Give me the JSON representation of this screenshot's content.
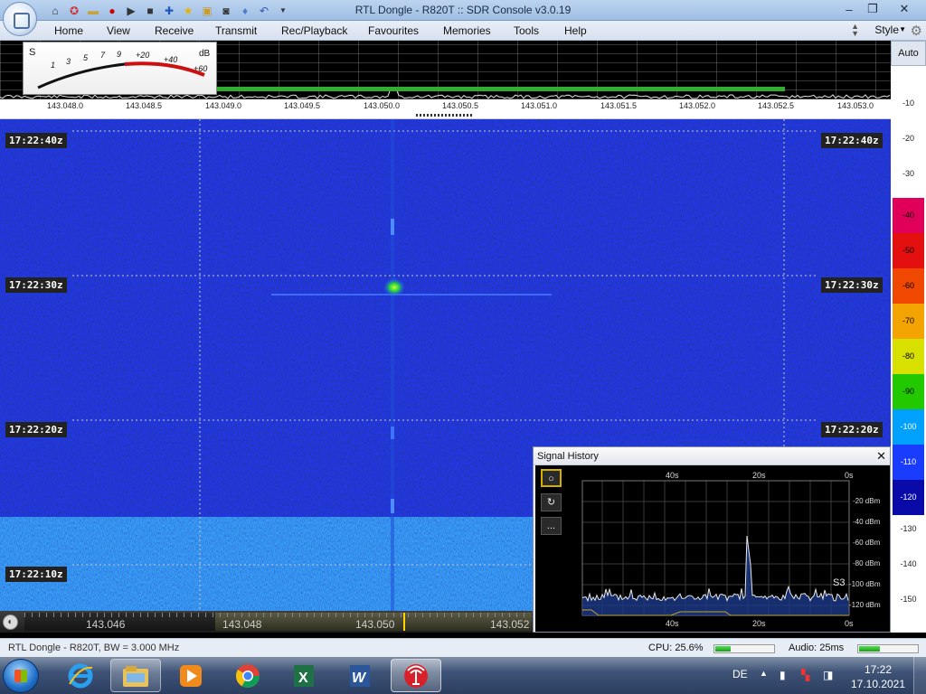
{
  "window": {
    "title": "RTL Dongle - R820T :: SDR Console v3.0.19",
    "minimize_icon": "minimize-icon",
    "maximize_icon": "maximize-icon",
    "close_icon": "close-icon"
  },
  "quick_access": [
    "home-icon",
    "lifebuoy-icon",
    "folder-icon",
    "record-icon",
    "play-icon",
    "stop-icon",
    "add-icon",
    "star-icon",
    "lock-icon",
    "camera-icon",
    "drop-icon",
    "undo-icon",
    "dropdown-icon"
  ],
  "menu": {
    "tabs": [
      "Home",
      "View",
      "Receive",
      "Transmit",
      "Rec/Playback",
      "Favourites",
      "Memories",
      "Tools",
      "Help"
    ],
    "style_label": "Style"
  },
  "smeter": {
    "s_label": "S",
    "db_label": "dB",
    "scale": [
      "1",
      "3",
      "5",
      "7",
      "9",
      "+20",
      "+40",
      "+60"
    ],
    "reading_fraction": 0.12
  },
  "spectrum": {
    "auto_label": "Auto",
    "freq_ticks": [
      "143.048.0",
      "143.048.5",
      "143.049.0",
      "143.049.5",
      "143.050.0",
      "143.050.5",
      "143.051.0",
      "143.051.5",
      "143.052.0",
      "143.052.5",
      "143.053.0"
    ]
  },
  "db_scale": {
    "labels": [
      "-10",
      "-20",
      "-30",
      "-40",
      "-50",
      "-60",
      "-70",
      "-80",
      "-90",
      "-100",
      "-110",
      "-120",
      "-130",
      "-140",
      "-150"
    ],
    "colored": [
      {
        "label": "-40",
        "color": "#e0005a"
      },
      {
        "label": "-50",
        "color": "#e41010"
      },
      {
        "label": "-60",
        "color": "#f04800"
      },
      {
        "label": "-70",
        "color": "#f4a400"
      },
      {
        "label": "-80",
        "color": "#d8e000"
      },
      {
        "label": "-90",
        "color": "#22c800"
      },
      {
        "label": "-100",
        "color": "#00a0ff"
      },
      {
        "label": "-110",
        "color": "#1a3cff"
      },
      {
        "label": "-120",
        "color": "#0a0aa8"
      }
    ]
  },
  "waterfall": {
    "timestamps": [
      "17:22:40z",
      "17:22:30z",
      "17:22:20z",
      "17:22:10z"
    ]
  },
  "tuning": {
    "labels": [
      "143.046",
      "143.048",
      "143.050",
      "143.052"
    ],
    "button_icon": "tune-icon"
  },
  "status": {
    "left": "RTL Dongle - R820T, BW = 3.000 MHz",
    "cpu": "CPU: 25.6%",
    "cpu_level": 0.256,
    "audio": "Audio: 25ms",
    "audio_level": 0.35
  },
  "signal_history": {
    "title": "Signal History",
    "close_icon": "close-icon",
    "buttons": [
      "record-circle-icon",
      "loop-icon",
      "more-icon"
    ],
    "more_label": "...",
    "time_labels": [
      "40s",
      "20s",
      "0s"
    ],
    "dbm_labels": [
      "-20 dBm",
      "-40 dBm",
      "-60 dBm",
      "-80 dBm",
      "-100 dBm",
      "-120 dBm"
    ],
    "s_reading": "S3"
  },
  "taskbar": {
    "apps": [
      "internet-explorer-icon",
      "file-explorer-icon",
      "media-player-icon",
      "chrome-icon",
      "excel-icon",
      "word-icon",
      "sdr-console-icon"
    ],
    "language": "DE",
    "time": "17:22",
    "date": "17.10.2021"
  }
}
